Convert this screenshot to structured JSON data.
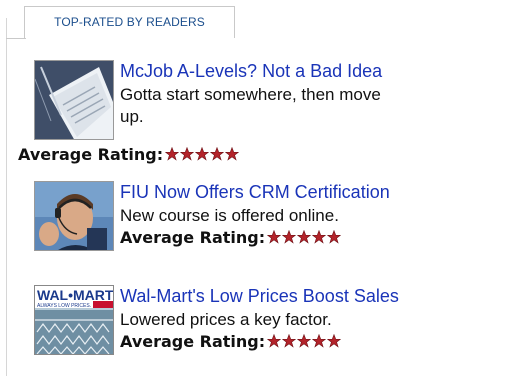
{
  "tab": {
    "label": "TOP-RATED BY READERS"
  },
  "articles": [
    {
      "title": "McJob A-Levels? Not a Bad Idea",
      "description": "Gotta start somewhere, then move up.",
      "rating_label": "Average Rating:",
      "rating_stars": 5,
      "thumb_icon": "resume-paper-image"
    },
    {
      "title": "FIU Now Offers CRM Certification",
      "description": "New course is offered online.",
      "rating_label": "Average Rating:",
      "rating_stars": 5,
      "thumb_icon": "headset-agent-photo"
    },
    {
      "title": "Wal-Mart's Low Prices Boost Sales",
      "description": "Lowered prices a key factor.",
      "rating_label": "Average Rating:",
      "rating_stars": 5,
      "thumb_icon": "walmart-store-photo",
      "thumb_text": {
        "brand": "WAL•MART",
        "slogan": "ALWAYS LOW PRICES."
      }
    }
  ],
  "colors": {
    "link": "#1a34b8",
    "tab_text": "#1c4f8d",
    "star": "#b3232a"
  }
}
